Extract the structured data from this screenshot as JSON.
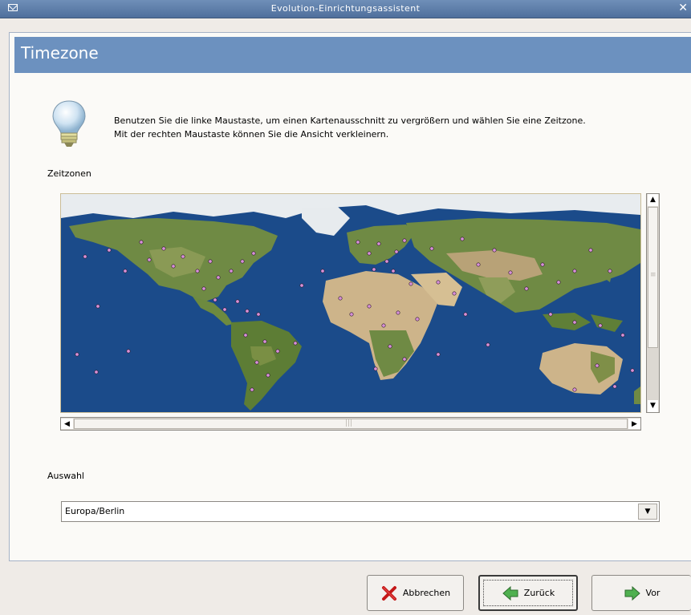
{
  "window": {
    "title": "Evolution-Einrichtungsassistent",
    "close_glyph": "✕"
  },
  "page": {
    "title": "Timezone"
  },
  "intro": {
    "line1": "Benutzen Sie die linke Maustaste, um einen Kartenausschnitt zu vergrößern und wählen Sie eine Zeitzone.",
    "line2": "Mit der rechten Maustaste können Sie die Ansicht verkleinern."
  },
  "timezones": {
    "label": "Zeitzonen"
  },
  "selection": {
    "label": "Auswahl",
    "value": "Europa/Berlin"
  },
  "buttons": {
    "cancel": {
      "label": "Abbrechen",
      "icon": "cancel-x-icon"
    },
    "back": {
      "label": "Zurück",
      "icon": "back-arrow-icon"
    },
    "forward": {
      "label": "Vor",
      "icon": "forward-arrow-icon"
    }
  },
  "colors": {
    "header": "#6c91bf",
    "ocean": "#1b4b8a",
    "land": "#6f8a44",
    "desert": "#cdb48a",
    "marker": "#d890d8"
  }
}
